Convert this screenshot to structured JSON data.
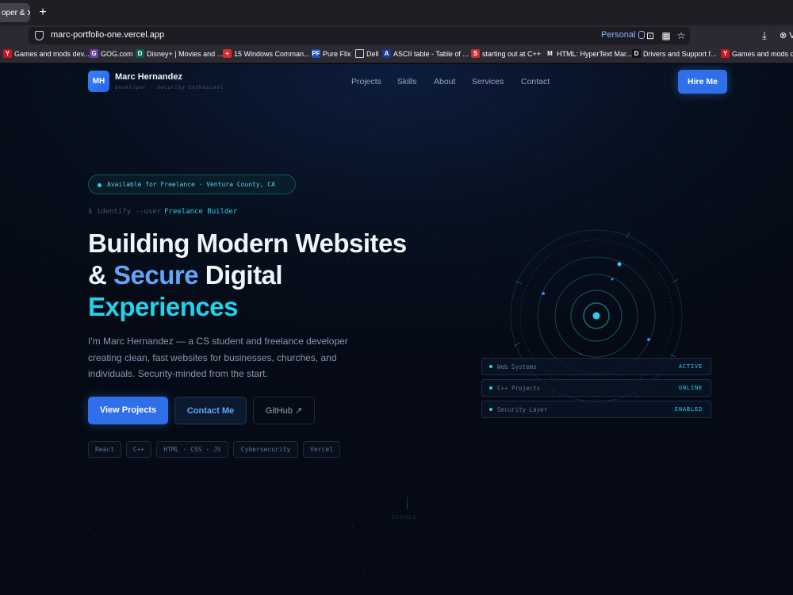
{
  "browser": {
    "tab_title": "oper &",
    "url": "marc-portfolio-one.vercel.app",
    "profile_label": "Personal",
    "profile_short": "V",
    "bookmarks": [
      {
        "label": "Games and mods dev...",
        "icon": "y-favicon",
        "color": "#c4161c",
        "glyph": "Y"
      },
      {
        "label": "GOG.com",
        "icon": "gog-favicon",
        "color": "#6b3fa0",
        "glyph": "G"
      },
      {
        "label": "Disney+ | Movies and ...",
        "icon": "disney-favicon",
        "color": "#0b5f4f",
        "glyph": "D"
      },
      {
        "label": "15 Windows Comman...",
        "icon": "red-favicon",
        "color": "#d92b2b",
        "glyph": "+"
      },
      {
        "label": "Pure Flix",
        "icon": "pf-favicon",
        "color": "#1d4fb8",
        "glyph": "PF"
      },
      {
        "label": "Dell",
        "icon": "folder-icon",
        "color": "#2b2a33",
        "glyph": ""
      },
      {
        "label": "ASCII table - Table of ...",
        "icon": "ascii-favicon",
        "color": "#1d3b8a",
        "glyph": "A"
      },
      {
        "label": "starting out at C++",
        "icon": "doc-favicon",
        "color": "#c53030",
        "glyph": "S"
      },
      {
        "label": "HTML: HyperText Mar...",
        "icon": "mdn-favicon",
        "color": "#2b2a33",
        "glyph": "M"
      },
      {
        "label": "Drivers and Support f...",
        "icon": "dell-favicon",
        "color": "#111111",
        "glyph": "D"
      },
      {
        "label": "Games and mods dev...",
        "icon": "y-favicon",
        "color": "#c4161c",
        "glyph": "Y"
      }
    ]
  },
  "site": {
    "logo": "MH",
    "name": "Marc Hernandez",
    "tagline": "Developer · Security Enthusiast",
    "nav": [
      "Projects",
      "Skills",
      "About",
      "Services",
      "Contact"
    ],
    "hire_label": "Hire Me",
    "availability": "Available for Freelance · Ventura County, CA",
    "cmd_prefix": "$ identify --user",
    "cmd_value": "Freelance Builder",
    "headline": {
      "line1": "Building Modern Websites",
      "line2_a": "& ",
      "line2_b": "Secure",
      "line2_c": " Digital",
      "line3": "Experiences"
    },
    "description": "I'm Marc Hernandez — a CS student and freelance developer creating clean, fast websites for businesses, churches, and individuals. Security-minded from the start.",
    "buttons": {
      "primary": "View Projects",
      "secondary": "Contact Me",
      "ghost": "GitHub ↗"
    },
    "tags": [
      "React",
      "C++",
      "HTML · CSS · JS",
      "Cybersecurity",
      "Vercel"
    ],
    "status": [
      {
        "label": "Web Systems",
        "value": "ACTIVE"
      },
      {
        "label": "C++ Projects",
        "value": "ONLINE"
      },
      {
        "label": "Security Layer",
        "value": "ENABLED"
      }
    ],
    "scroll_label": "SCROLL"
  },
  "colors": {
    "accent_blue": "#2f6fea",
    "accent_cyan": "#22d3ee",
    "background": "#050a14"
  }
}
